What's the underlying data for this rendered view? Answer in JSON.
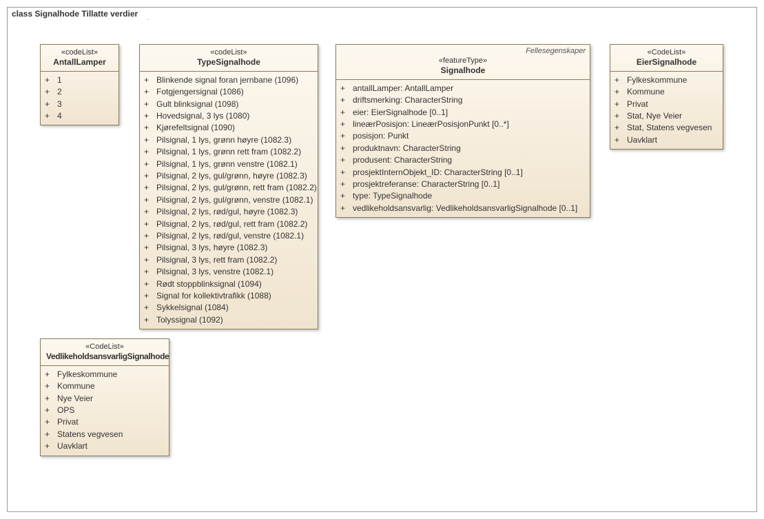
{
  "frame": {
    "title": "class Signalhode Tillatte verdier"
  },
  "antallLamper": {
    "stereotype": "«codeList»",
    "name": "AntallLamper",
    "items": [
      "1",
      "2",
      "3",
      "4"
    ]
  },
  "typeSignalhode": {
    "stereotype": "«codeList»",
    "name": "TypeSignalhode",
    "items": [
      "Blinkende signal foran jernbane (1096)",
      "Fotgjengersignal (1086)",
      "Gult blinksignal (1098)",
      "Hovedsignal, 3 lys (1080)",
      "Kjørefeltsignal (1090)",
      "Pilsignal, 1 lys, grønn høyre (1082.3)",
      "Pilsignal, 1 lys, grønn rett fram (1082.2)",
      "Pilsignal, 1 lys, grønn venstre (1082.1)",
      "Pilsignal, 2 lys, gul/grønn, høyre (1082.3)",
      "Pilsignal, 2 lys, gul/grønn, rett fram (1082.2)",
      "Pilsignal, 2 lys, gul/grønn, venstre (1082.1)",
      "Pilsignal, 2 lys, rød/gul, høyre (1082.3)",
      "Pilsignal, 2 lys, rød/gul, rett fram (1082.2)",
      "Pilsignal, 2 lys, rød/gul, venstre (1082.1)",
      "Pilsignal, 3 lys, høyre (1082.3)",
      "Pilsignal, 3 lys, rett fram (1082.2)",
      "Pilsignal, 3 lys, venstre (1082.1)",
      "Rødt stoppblinksignal (1094)",
      "Signal for kollektivtrafikk (1088)",
      "Sykkelsignal (1084)",
      "Tolyssignal (1092)"
    ]
  },
  "signalhode": {
    "corner": "Fellesegenskaper",
    "stereotype": "«featureType»",
    "name": "Signalhode",
    "attrs": [
      "antallLamper: AntallLamper",
      "driftsmerking: CharacterString",
      "eier: EierSignalhode [0..1]",
      "lineærPosisjon: LineærPosisjonPunkt [0..*]",
      "posisjon: Punkt",
      "produktnavn: CharacterString",
      "produsent: CharacterString",
      "prosjektInternObjekt_ID: CharacterString [0..1]",
      "prosjektreferanse: CharacterString [0..1]",
      "type: TypeSignalhode",
      "vedlikeholdsansvarlig: VedlikeholdsansvarligSignalhode [0..1]"
    ]
  },
  "eierSignalhode": {
    "stereotype": "«CodeList»",
    "name": "EierSignalhode",
    "items": [
      "Fylkeskommune",
      "Kommune",
      "Privat",
      "Stat, Nye Veier",
      "Stat, Statens vegvesen",
      "Uavklart"
    ]
  },
  "vedlikehold": {
    "stereotype": "«CodeList»",
    "name": "VedlikeholdsansvarligSignalhode",
    "items": [
      "Fylkeskommune",
      "Kommune",
      "Nye Veier",
      "OPS",
      "Privat",
      "Statens vegvesen",
      "Uavklart"
    ]
  }
}
